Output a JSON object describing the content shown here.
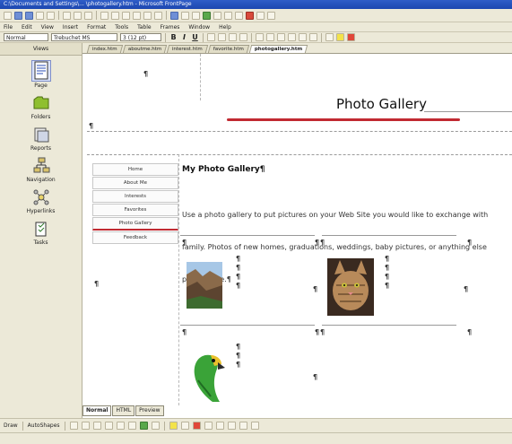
{
  "window": {
    "title": "C:\\Documents and Settings\\... \\photogallery.htm - Microsoft FrontPage"
  },
  "menubar": {
    "items": [
      "File",
      "Edit",
      "View",
      "Insert",
      "Format",
      "Tools",
      "Table",
      "Frames",
      "Window",
      "Help"
    ]
  },
  "formatting": {
    "style": "Normal",
    "font": "Trebuchet MS",
    "size": "3 (12 pt)",
    "bold": "B",
    "italic": "I",
    "underline": "U"
  },
  "sidebar": {
    "header": "Views",
    "items": [
      {
        "label": "Page",
        "icon": "page-view-icon"
      },
      {
        "label": "Folders",
        "icon": "folders-view-icon"
      },
      {
        "label": "Reports",
        "icon": "reports-view-icon"
      },
      {
        "label": "Navigation",
        "icon": "navigation-view-icon"
      },
      {
        "label": "Hyperlinks",
        "icon": "hyperlinks-view-icon"
      },
      {
        "label": "Tasks",
        "icon": "tasks-view-icon"
      }
    ]
  },
  "doc_tabs": [
    "index.htm",
    "aboutme.htm",
    "interest.htm",
    "favorite.htm",
    "photogallery.htm"
  ],
  "page": {
    "para_mark": "¶",
    "title": "Photo Gallery",
    "heading": "My Photo Gallery¶",
    "intro_lines": [
      "Use a photo gallery to put pictures on your Web Site you would like to exchange with",
      "family. Photos of new homes, graduations, weddings, baby pictures, or anything else",
      "placed here.¶"
    ],
    "nav_buttons": [
      "Home",
      "About Me",
      "Interests",
      "Favorites",
      "Photo Gallery",
      "Feedback"
    ],
    "current_nav": "Photo Gallery"
  },
  "photos": [
    {
      "name": "canyon-photo",
      "icon": "canyon-landscape"
    },
    {
      "name": "cat-photo",
      "icon": "tabby-cat"
    },
    {
      "name": "parrot-photo",
      "icon": "green-parrot"
    }
  ],
  "bottom_tabs": [
    "Normal",
    "HTML",
    "Preview"
  ],
  "drawing": {
    "draw_label": "Draw",
    "autoshapes_label": "AutoShapes"
  },
  "colors": {
    "accent_red": "#c12a32",
    "toolbar_bg": "#ece9d8",
    "titlebar_blue": "#2f5dc8"
  }
}
